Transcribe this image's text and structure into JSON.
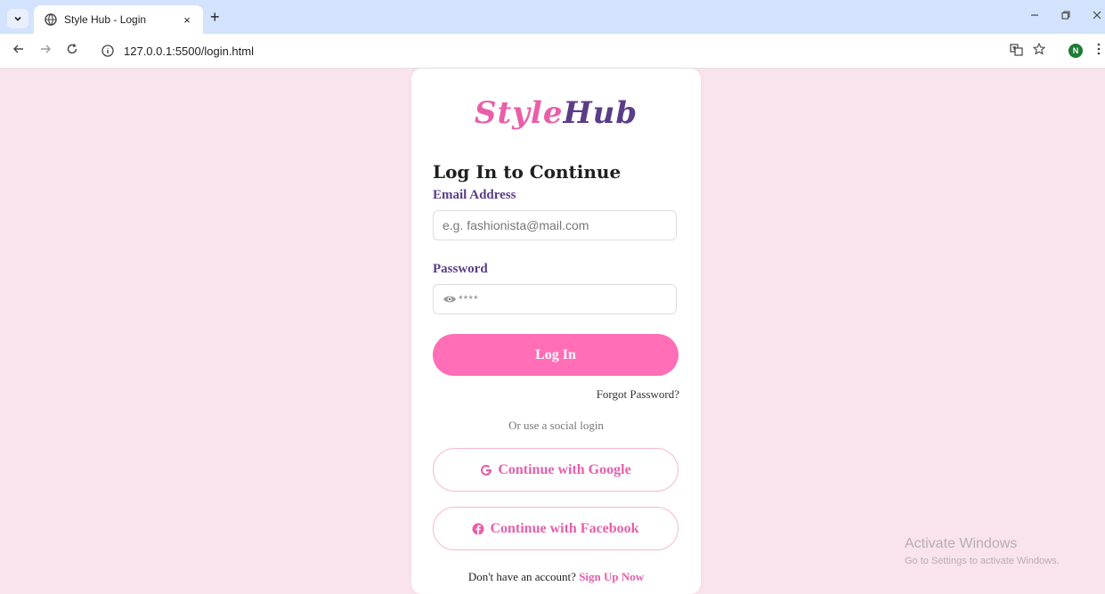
{
  "browser": {
    "tab_title": "Style Hub - Login",
    "tab_close": "×",
    "new_tab": "+",
    "url": "127.0.0.1:5500/login.html",
    "avatar_letter": "N",
    "dropdown_icon": "chevron-down-icon"
  },
  "page": {
    "logo_part1": "Style",
    "logo_part2": "Hub",
    "heading": "Log In to Continue",
    "email_label": "Email Address",
    "email_placeholder": "e.g. fashionista@mail.com",
    "password_label": "Password",
    "password_mask": "****",
    "login_button": "Log In",
    "forgot_password": "Forgot Password?",
    "social_text": "Or use a social login",
    "google_button": "Continue with Google",
    "facebook_button": "Continue with Facebook",
    "signup_prompt": "Don't have an account?",
    "signup_link": "Sign Up Now"
  },
  "watermark": {
    "line1": "Activate Windows",
    "line2": "Go to Settings to activate Windows."
  },
  "colors": {
    "page_bg": "#f9e3ec",
    "accent_pink": "#ff6eb6",
    "logo_pink": "#e95ea9",
    "logo_purple": "#5b3c88"
  }
}
